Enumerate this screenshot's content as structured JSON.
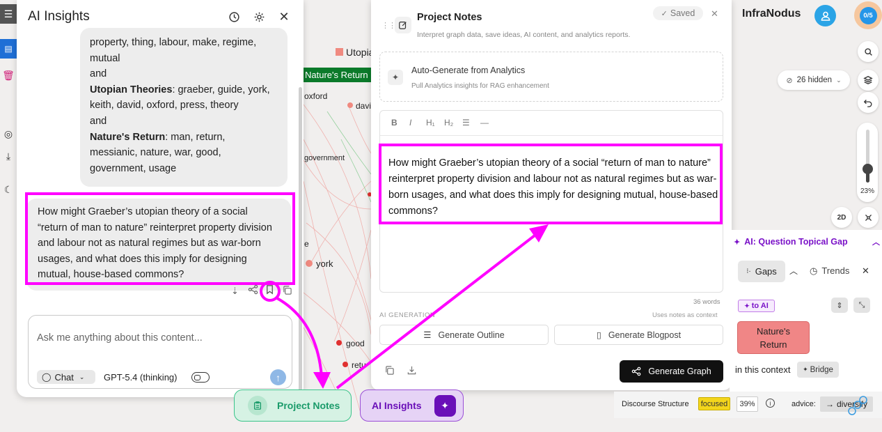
{
  "app": {
    "brand": "InfraNodus",
    "counter": "0/5"
  },
  "graph": {
    "labels": [
      "Utopia",
      "Nature's Return",
      "oxford",
      "davi",
      "government",
      "e",
      "york",
      "good",
      "retu"
    ]
  },
  "ai_insights": {
    "title": "AI Insights",
    "assistant_message": {
      "line1": "property, thing, labour, make, regime,",
      "line2": "mutual",
      "and": "and",
      "topic2_name": "Utopian Theories",
      "topic2_terms_a": ": graeber, guide, york,",
      "topic2_terms_b": "keith, david, oxford, press, theory",
      "topic3_name": "Nature's Return",
      "topic3_terms_a": ": man, return,",
      "topic3_terms_b": "messianic, nature, war, good,",
      "topic3_terms_c": "government, usage"
    },
    "question_message": "How might Graeber’s utopian theory of a social “return of man to nature” reinterpret property division and labour not as natural regimes but as war-born usages, and what does this imply for designing mutual, house-based commons?",
    "input_placeholder": "Ask me anything about this content...",
    "chat_mode": "Chat",
    "model": "GPT-5.4 (thinking)"
  },
  "project_notes": {
    "title": "Project Notes",
    "subtitle": "Interpret graph data, save ideas, AI content, and analytics reports.",
    "saved_label": "Saved",
    "autogen_title": "Auto-Generate from Analytics",
    "autogen_sub": "Pull Analytics insights for RAG enhancement",
    "toolbar": {
      "bold": "B",
      "italic": "I",
      "h1": "H₁",
      "h2": "H₂"
    },
    "note_text": "How might Graeber’s utopian theory of a social “return of man to nature” reinterpret property division and labour not as natural regimes but as war-born usages, and what does this imply for designing mutual, house-based commons?",
    "word_count": "36 words",
    "ai_gen_label": "AI GENERATION",
    "uses_notes": "Uses notes as context",
    "generate_outline": "Generate Outline",
    "generate_blogpost": "Generate Blogpost",
    "generate_graph": "Generate Graph"
  },
  "bottom_tabs": {
    "notes": "Project Notes",
    "ai": "AI Insights"
  },
  "right_sidebar": {
    "hidden_pill": "26 hidden",
    "zoom_level": 0.23,
    "zoom_label": "23%",
    "view_mode": "2D",
    "ai_gap_header": "AI: Question Topical Gap",
    "gaps_tab": "Gaps",
    "trends_tab": "Trends",
    "to_ai": "to AI",
    "nature_return_node": "Nature's Return",
    "in_context": "in this context",
    "bridge": "Bridge",
    "discourse_label": "Discourse Structure",
    "focused": "focused",
    "percent": "39%",
    "advice_label": "advice:",
    "diversify": "diversify"
  },
  "colors": {
    "highlight": "#ff00ff",
    "nature_green": "#0b7a2a",
    "node_red": "#e03030",
    "node_pink": "#f08a80",
    "ai_purple": "#7a12c8",
    "notes_green": "#1a9b6a"
  }
}
